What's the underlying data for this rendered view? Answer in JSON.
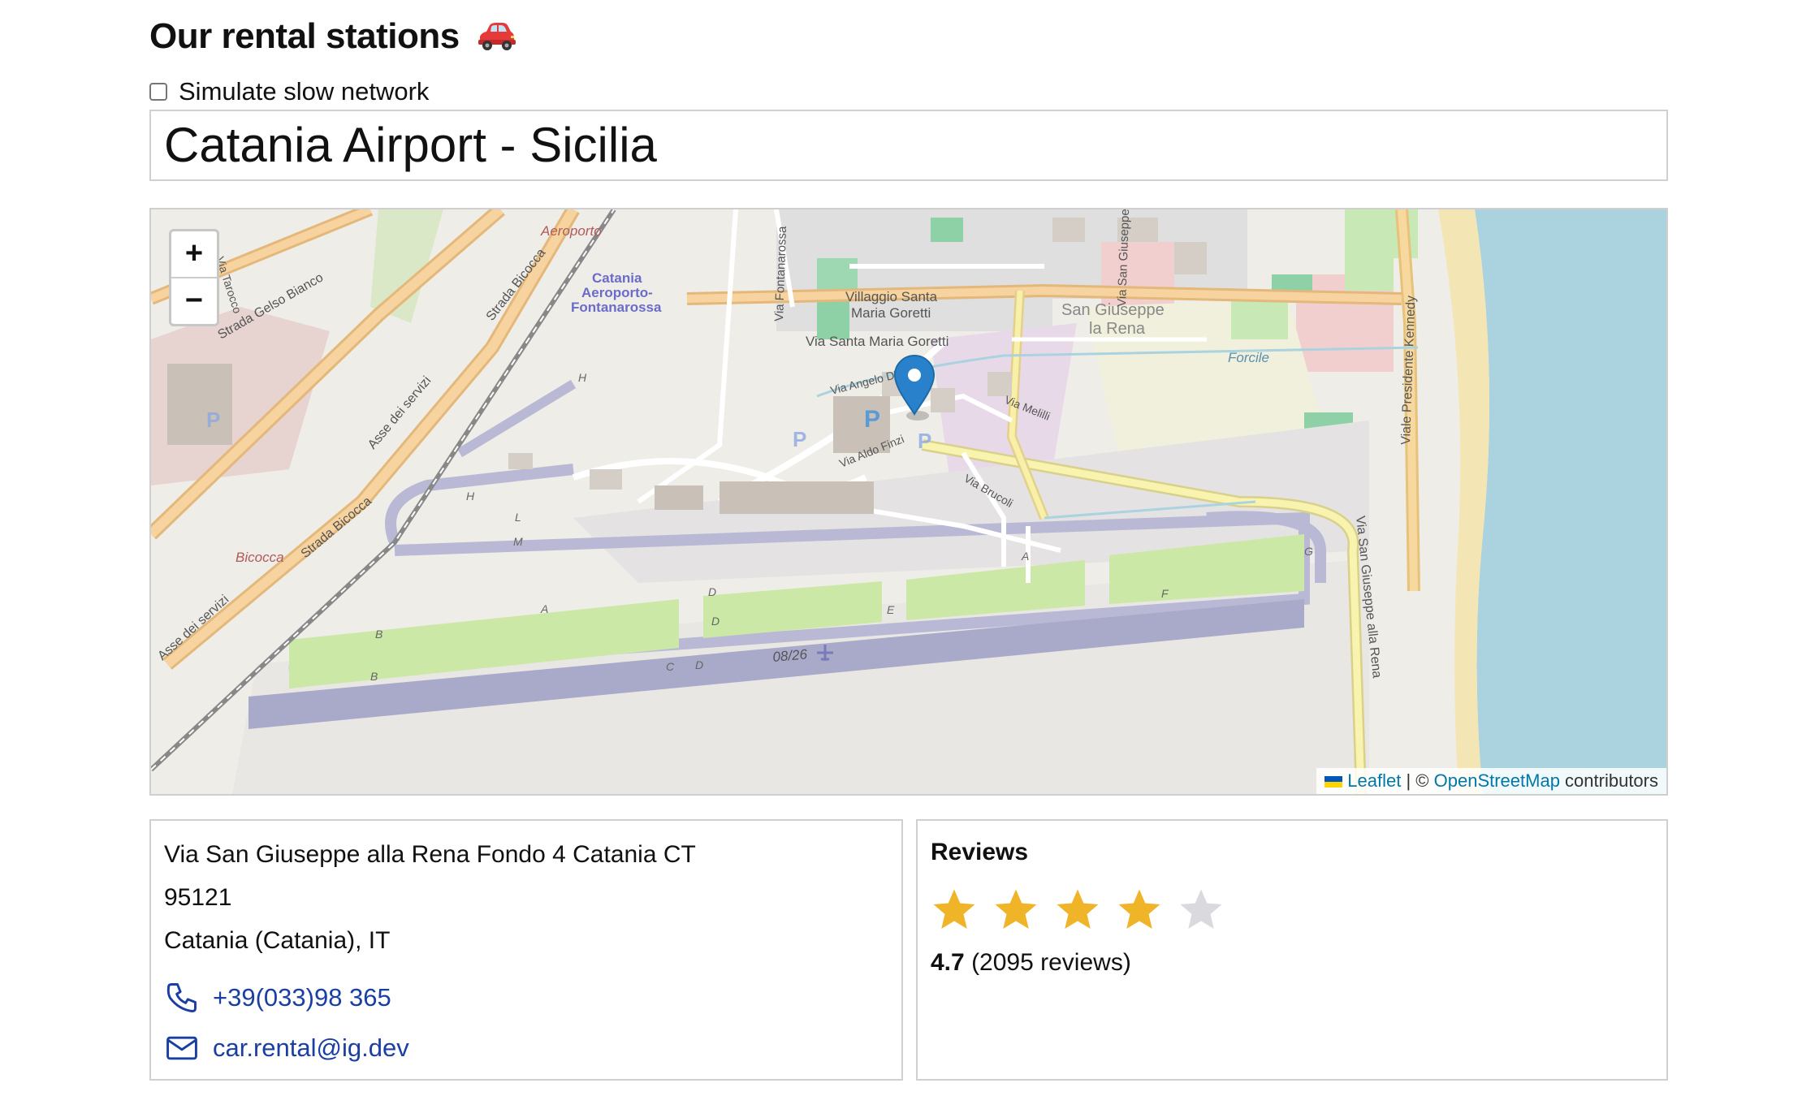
{
  "page": {
    "title": "Our rental stations",
    "title_icon": "red-car-emoji"
  },
  "options": {
    "slow_network_label": "Simulate slow network",
    "slow_network_checked": false
  },
  "station": {
    "selected": "Catania Airport - Sicilia"
  },
  "map": {
    "zoom_in": "+",
    "zoom_out": "−",
    "attribution": {
      "leaflet": "Leaflet",
      "separator": " | © ",
      "osm": "OpenStreetMap",
      "suffix": " contributors"
    },
    "labels": {
      "aeroporto": "Aeroporto",
      "station_1": "Catania",
      "station_2": "Aeroporto-",
      "station_3": "Fontanarossa",
      "villaggio_1": "Villaggio Santa",
      "villaggio_2": "Maria Goretti",
      "via_smg": "Via Santa Maria Goretti",
      "san_giuseppe_1": "San Giuseppe",
      "san_giuseppe_2": "la Rena",
      "forcile": "Forcile",
      "via_dangelo": "Via Angelo D'Arrigo",
      "via_melilli": "Via Melilli",
      "via_aldo_finzi": "Via Aldo Finzi",
      "via_brucoli": "Via Brucoli",
      "strada_gelso": "Strada Gelso Bianco",
      "strada_bicocca_1": "Strada Bicocca",
      "strada_bicocca_2": "Strada Bicocca",
      "asse_servizi_1": "Asse dei servizi",
      "asse_servizi_2": "Asse dei servizi",
      "bicocca": "Bicocca",
      "viale_kennedy": "Viale Presidente Kennedy",
      "via_sg_rena": "Via San Giuseppe alla Rena",
      "via_fontanarossa": "Via Fontanarossa",
      "via_san_giuseppe": "Via San Giuseppe",
      "via_tarocco": "Via Tarocco",
      "runway": "08/26",
      "twy_a1": "A",
      "twy_a2": "A",
      "twy_b1": "B",
      "twy_b2": "B",
      "twy_c": "C",
      "twy_d1": "D",
      "twy_d2": "D",
      "twy_d3": "D",
      "twy_e": "E",
      "twy_f": "F",
      "twy_g": "G",
      "twy_h1": "H",
      "twy_h2": "H",
      "twy_l": "L",
      "twy_m": "M",
      "parking": "P"
    }
  },
  "address": {
    "street": "Via San Giuseppe alla Rena Fondo 4 Catania CT",
    "postcode": "95121",
    "city": "Catania (Catania), IT",
    "phone": "+39(033)98 365",
    "email": "car.rental@ig.dev"
  },
  "reviews": {
    "title": "Reviews",
    "rating": "4.7",
    "count_text": "(2095 reviews)",
    "filled_stars": 4,
    "total_stars": 5,
    "star_color": "#f0b429",
    "empty_star_color": "#d9d9de"
  }
}
